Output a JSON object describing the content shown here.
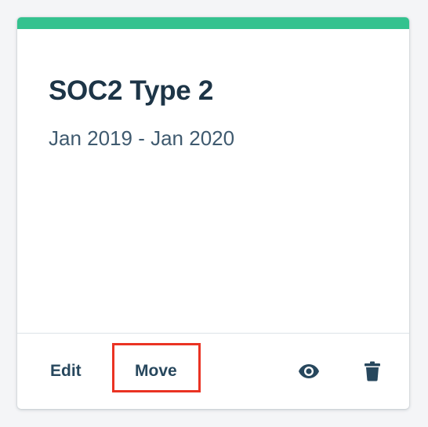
{
  "card": {
    "title": "SOC2 Type 2",
    "dates": "Jan 2019 - Jan 2020",
    "accent_color": "#34c28f"
  },
  "actions": {
    "edit_label": "Edit",
    "move_label": "Move",
    "view_icon": "eye-icon",
    "delete_icon": "trash-icon"
  },
  "highlight": {
    "target": "Move",
    "color": "#ea3323"
  }
}
